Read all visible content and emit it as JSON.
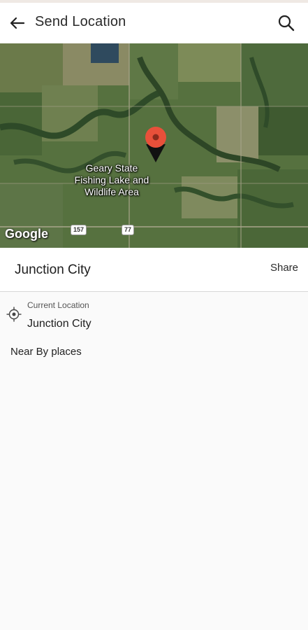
{
  "appbar": {
    "title": "Send Location",
    "back_icon": "arrow-left-icon",
    "search_icon": "search-icon"
  },
  "map": {
    "area_label": "Geary State Fishing Lake and Wildlife Area",
    "attribution": "Google",
    "route_shields": [
      "157",
      "77"
    ],
    "pin_color": "#e8503a"
  },
  "location": {
    "title": "Junction City",
    "share_label": "Share"
  },
  "current_location": {
    "caption": "Current Location",
    "name": "Junction City",
    "icon": "crosshair-target-icon"
  },
  "nearby": {
    "heading": "Near By places"
  }
}
